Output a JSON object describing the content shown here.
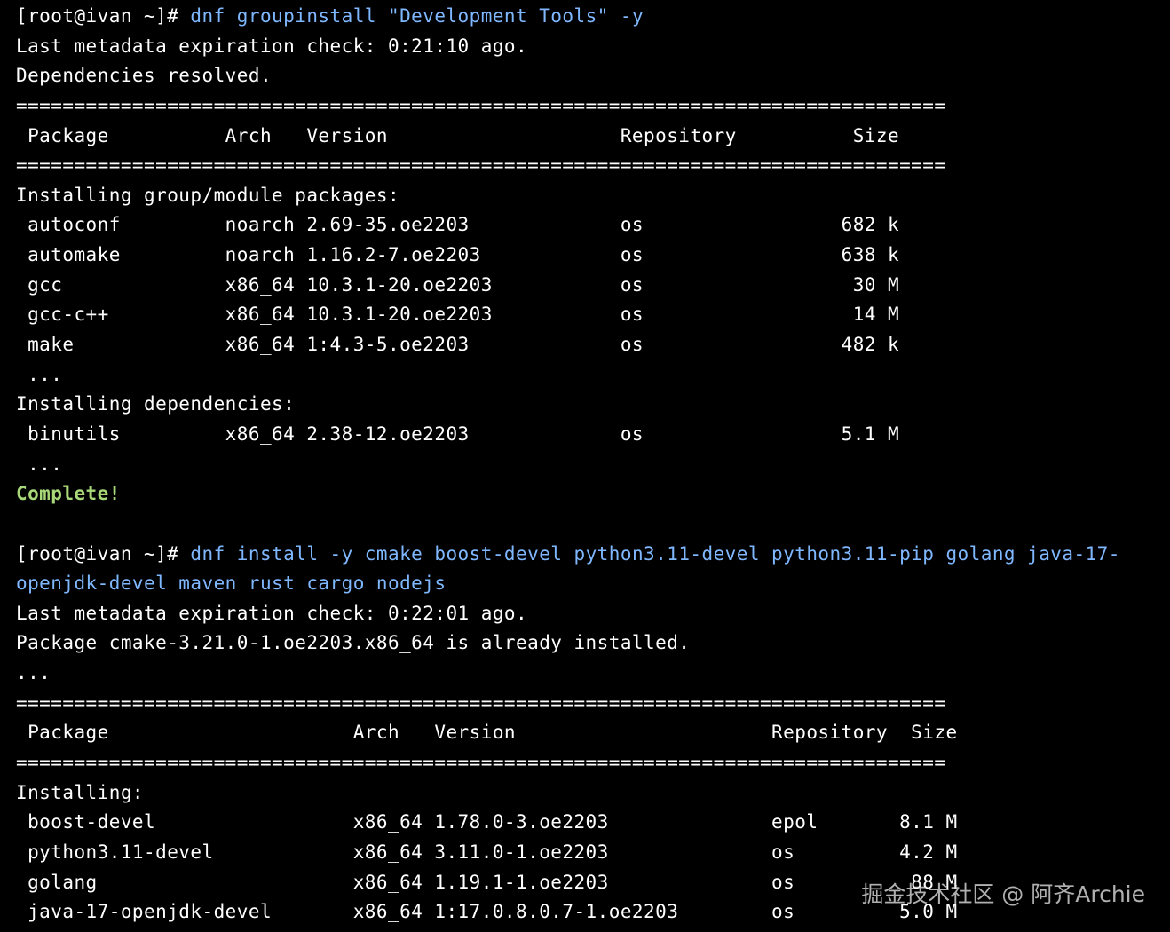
{
  "colors": {
    "background": "#000000",
    "text": "#ffffff",
    "command": "#7fb8ff",
    "success": "#a8d878"
  },
  "terminal": {
    "lines": [
      {
        "prompt": "[root@ivan ~]# ",
        "command": "dnf groupinstall \"Development Tools\" -y"
      },
      {
        "text": "Last metadata expiration check: 0:21:10 ago."
      },
      {
        "text": "Dependencies resolved."
      },
      {
        "text": "================================================================================"
      },
      {
        "text": " Package          Arch   Version                    Repository          Size"
      },
      {
        "text": "================================================================================"
      },
      {
        "text": "Installing group/module packages:"
      },
      {
        "text": " autoconf         noarch 2.69-35.oe2203             os                 682 k"
      },
      {
        "text": " automake         noarch 1.16.2-7.oe2203            os                 638 k"
      },
      {
        "text": " gcc              x86_64 10.3.1-20.oe2203           os                  30 M"
      },
      {
        "text": " gcc-c++          x86_64 10.3.1-20.oe2203           os                  14 M"
      },
      {
        "text": " make             x86_64 1:4.3-5.oe2203             os                 482 k"
      },
      {
        "text": " ..."
      },
      {
        "text": "Installing dependencies:"
      },
      {
        "text": " binutils         x86_64 2.38-12.oe2203             os                 5.1 M"
      },
      {
        "text": " ..."
      },
      {
        "text": "Complete!",
        "kind": "success"
      },
      {
        "text": ""
      },
      {
        "prompt": "[root@ivan ~]# ",
        "command": "dnf install -y cmake boost-devel python3.11-devel python3.11-pip golang java-17-"
      },
      {
        "command": "openjdk-devel maven rust cargo nodejs"
      },
      {
        "text": "Last metadata expiration check: 0:22:01 ago."
      },
      {
        "text": "Package cmake-3.21.0-1.oe2203.x86_64 is already installed."
      },
      {
        "text": "..."
      },
      {
        "text": "================================================================================"
      },
      {
        "text": " Package                     Arch   Version                      Repository  Size"
      },
      {
        "text": "================================================================================"
      },
      {
        "text": "Installing:"
      },
      {
        "text": " boost-devel                 x86_64 1.78.0-3.oe2203              epol       8.1 M"
      },
      {
        "text": " python3.11-devel            x86_64 3.11.0-1.oe2203              os         4.2 M"
      },
      {
        "text": " golang                      x86_64 1.19.1-1.oe2203              os          88 M"
      },
      {
        "text": " java-17-openjdk-devel       x86_64 1:17.0.8.0.7-1.oe2203        os         5.0 M"
      }
    ]
  },
  "watermark": "掘金技术社区 @ 阿齐Archie"
}
